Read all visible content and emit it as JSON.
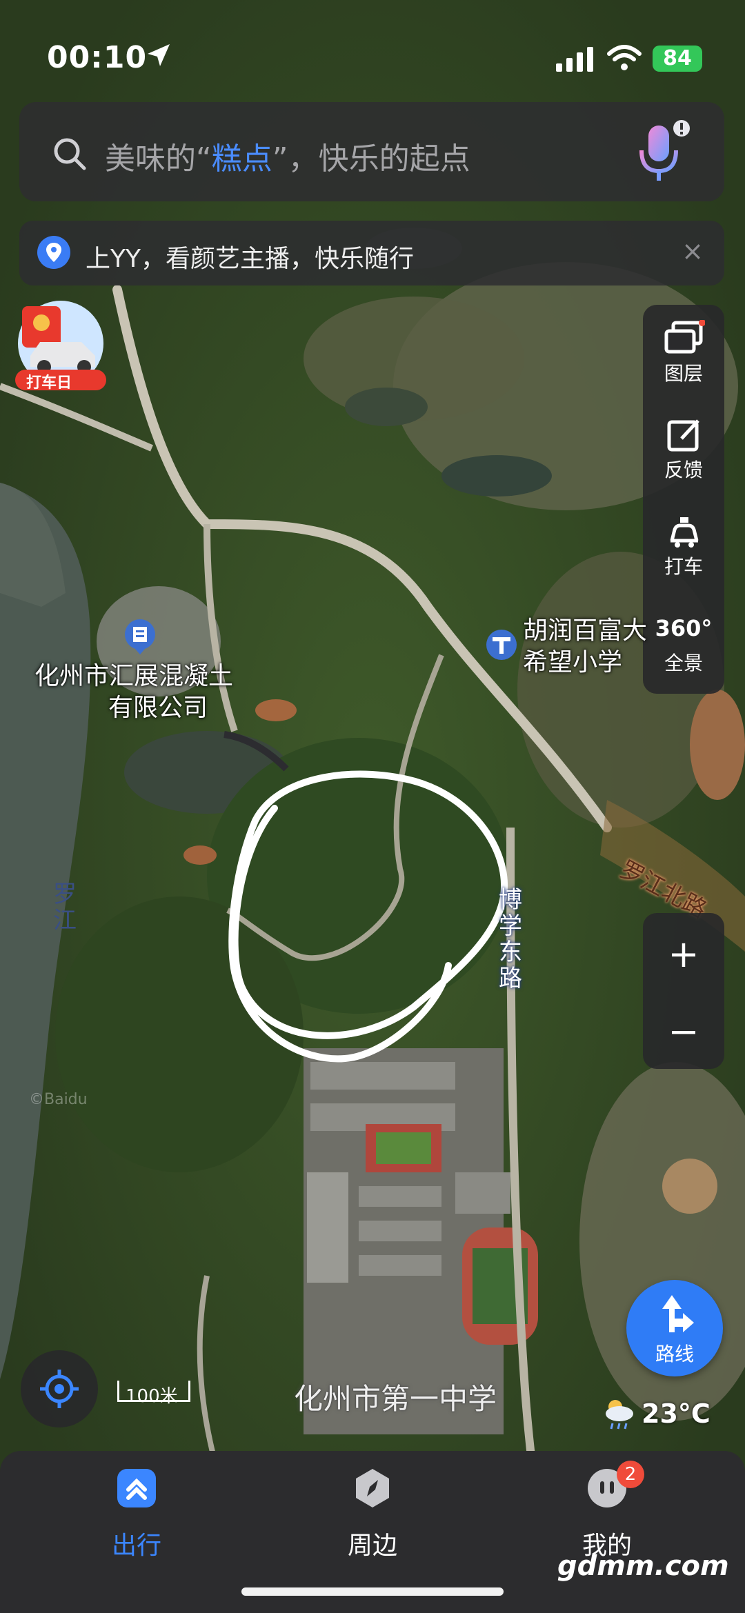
{
  "status": {
    "time": "00:10",
    "battery": "84"
  },
  "search": {
    "prefix": "美味的“",
    "highlight": "糕点",
    "suffix": "”，快乐的起点"
  },
  "banner": {
    "text": "上YY，看颜艺主播，快乐随行",
    "close": "×"
  },
  "promo": {
    "label": "打车日"
  },
  "side_tools": {
    "layers": "图层",
    "feedback": "反馈",
    "taxi": "打车",
    "panorama_badge": "360°",
    "panorama": "全景"
  },
  "zoom": {
    "in": "+",
    "out": "−"
  },
  "map_labels": {
    "company": [
      "化州市汇展混凝土",
      "有限公司"
    ],
    "school": [
      "胡润百富大",
      "希望小学"
    ],
    "river": "罗江",
    "road_east": "博学东路",
    "road_north": "罗江北路",
    "high_school": "化州市第一中学",
    "watermark": "©Baidu"
  },
  "scale": "100米",
  "route": {
    "label": "路线"
  },
  "weather": {
    "temp": "23°C"
  },
  "tabs": [
    {
      "label": "出行",
      "active": true
    },
    {
      "label": "周边",
      "active": false
    },
    {
      "label": "我的",
      "active": false,
      "badge": "2"
    }
  ],
  "watermark_site": "gdmm.com",
  "colors": {
    "accent": "#2f7cf6",
    "tab_active": "#3b86ff",
    "badge": "#f04b3a"
  }
}
